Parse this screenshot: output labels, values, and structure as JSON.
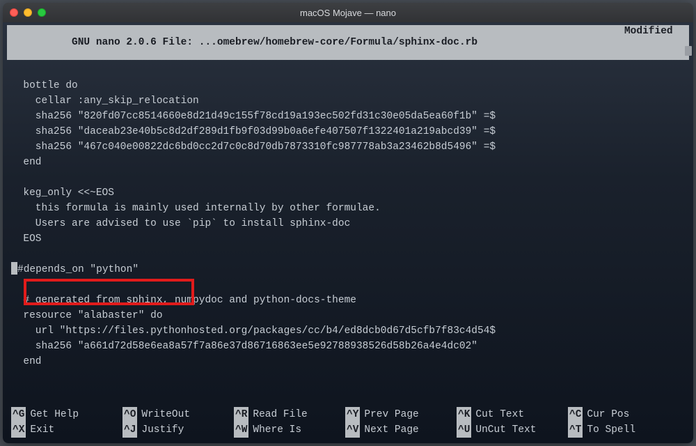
{
  "window": {
    "title": "macOS Mojave — nano"
  },
  "status": {
    "app": "  GNU nano 2.0.6",
    "file_label": " File: ",
    "file_path": "...omebrew/homebrew-core/Formula/sphinx-doc.rb",
    "modified": "Modified  "
  },
  "editor_lines": [
    "",
    "  bottle do",
    "    cellar :any_skip_relocation",
    "    sha256 \"820fd07cc8514660e8d21d49c155f78cd19a193ec502fd31c30e05da5ea60f1b\" =$",
    "    sha256 \"daceab23e40b5c8d2df289d1fb9f03d99b0a6efe407507f1322401a219abcd39\" =$",
    "    sha256 \"467c040e00822dc6bd0cc2d7c0c8d70db7873310fc987778ab3a23462b8d5496\" =$",
    "  end",
    "",
    "  keg_only <<~EOS",
    "    this formula is mainly used internally by other formulae.",
    "    Users are advised to use `pip` to install sphinx-doc",
    "  EOS",
    "",
    "  #depends_on \"python\"",
    "",
    "  # generated from sphinx, numpydoc and python-docs-theme",
    "  resource \"alabaster\" do",
    "    url \"https://files.pythonhosted.org/packages/cc/b4/ed8dcb0d67d5cfb7f83c4d54$",
    "    sha256 \"a661d72d58e6ea8a57f7a86e37d86716863ee5e92788938526d58b26a4e4dc02\"",
    "  end",
    ""
  ],
  "cursor_line_index": 13,
  "help": {
    "row1": [
      {
        "key": "^G",
        "label": "Get Help"
      },
      {
        "key": "^O",
        "label": "WriteOut"
      },
      {
        "key": "^R",
        "label": "Read File"
      },
      {
        "key": "^Y",
        "label": "Prev Page"
      },
      {
        "key": "^K",
        "label": "Cut Text"
      },
      {
        "key": "^C",
        "label": "Cur Pos"
      }
    ],
    "row2": [
      {
        "key": "^X",
        "label": "Exit"
      },
      {
        "key": "^J",
        "label": "Justify"
      },
      {
        "key": "^W",
        "label": "Where Is"
      },
      {
        "key": "^V",
        "label": "Next Page"
      },
      {
        "key": "^U",
        "label": "UnCut Text"
      },
      {
        "key": "^T",
        "label": "To Spell"
      }
    ]
  },
  "highlight": {
    "purpose": "red-annotation-box",
    "target_line": "#depends_on \"python\""
  }
}
